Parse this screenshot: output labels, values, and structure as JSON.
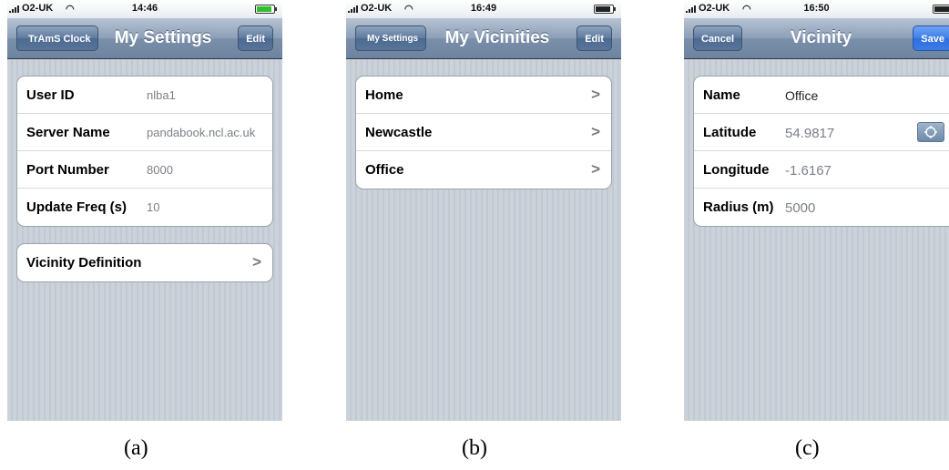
{
  "panels": [
    {
      "status": {
        "carrier": "O2-UK",
        "time": "14:46"
      },
      "nav": {
        "back": "TrAmS Clock",
        "title": "My Settings",
        "action": "Edit"
      },
      "settings": [
        {
          "label": "User ID",
          "value": "nlba1"
        },
        {
          "label": "Server Name",
          "value": "pandabook.ncl.ac.uk"
        },
        {
          "label": "Port Number",
          "value": "8000"
        },
        {
          "label": "Update Freq (s)",
          "value": "10"
        }
      ],
      "link": {
        "label": "Vicinity Definition"
      },
      "caption": "(a)"
    },
    {
      "status": {
        "carrier": "O2-UK",
        "time": "16:49"
      },
      "nav": {
        "back": "My Settings",
        "title": "My Vicinities",
        "action": "Edit"
      },
      "items": [
        {
          "label": "Home"
        },
        {
          "label": "Newcastle"
        },
        {
          "label": "Office"
        }
      ],
      "caption": "(b)"
    },
    {
      "status": {
        "carrier": "O2-UK",
        "time": "16:50"
      },
      "nav": {
        "left": "Cancel",
        "title": "Vicinity",
        "right": "Save"
      },
      "fields": [
        {
          "label": "Name",
          "value": "Office"
        },
        {
          "label": "Latitude",
          "value": "54.9817"
        },
        {
          "label": "Longitude",
          "value": "-1.6167"
        },
        {
          "label": "Radius (m)",
          "value": "5000"
        }
      ],
      "caption": "(c)"
    }
  ],
  "icons": {
    "chevron": "chevron-right-icon",
    "locate": "crosshair-icon",
    "wifi": "wifi-icon",
    "battery": "battery-icon",
    "signal": "signal-bars-icon"
  },
  "colors": {
    "nav_bar": "#7a8fa9",
    "save_button": "#3f7fe8",
    "value_text": "#7b7f88"
  }
}
